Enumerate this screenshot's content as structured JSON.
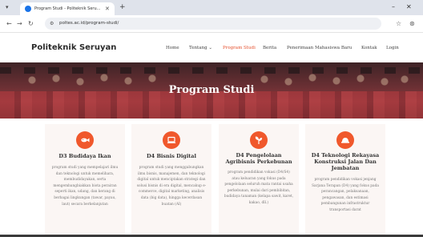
{
  "browser": {
    "tab_title": "Program Studi - Politeknik Seru...",
    "url": "poltes.ac.id/program-studi/",
    "tab_close_glyph": "✕",
    "new_tab_glyph": "+",
    "controls": {
      "minimize": "–",
      "maximize": "□",
      "close": "✕"
    },
    "icons": {
      "tab_list": "chevron-down-icon",
      "back": "arrow-left-icon",
      "forward": "arrow-right-icon",
      "reload": "reload-icon",
      "site_info": "tune-icon",
      "bookmark": "star-icon",
      "profile": "profile-icon"
    }
  },
  "site": {
    "brand": "Politeknik Seruyan",
    "nav": [
      {
        "label": "Home"
      },
      {
        "label": "Tentang ⌄"
      },
      {
        "label": "Program Studi"
      },
      {
        "label": "Berita"
      },
      {
        "label": "Penerimaan Mahasiswa Baru"
      },
      {
        "label": "Kontak"
      },
      {
        "label": "Login"
      }
    ],
    "active_nav": "Program Studi"
  },
  "hero": {
    "title": "Program Studi"
  },
  "programs": [
    {
      "icon": "fish-icon",
      "title": "D3 Budidaya Ikan",
      "description": "program studi yang mempelajari ilmu dan teknologi untuk memelihara, membudidayakan, serta mengembangbiakkan biota perairan seperti ikan, udang, dan kerang di berbagai lingkungan (tawar, payau, laut) secara berkelanjutan"
    },
    {
      "icon": "laptop-icon",
      "title": "D4 Bisnis Digital",
      "description": "program studi yang menggabungkan ilmu bisnis, manajemen, dan teknologi digital untuk menciptakan strategi dan solusi bisnis di era digital, mencakup e-commerce, digital marketing, analisis data (big data), hingga kecerdasan buatan (AI)"
    },
    {
      "icon": "plant-icon",
      "title": "D4 Pengelolaan Agribisnis Perkebunan",
      "description": "program pendidikan vokasi (D4/S4) atau keluaran yang fokus pada pengelolaan seluruh mata rantai usaha perkebunan, mulai dari pembibitan, budidaya tanaman (kelapa sawit, karet, kakao, dll.)"
    },
    {
      "icon": "construction-icon",
      "title": "D4 Teknologi Rekayasa Konstruksi Jalan Dan Jembatan",
      "description": "program pendidikan vokasi jenjang Sarjana Terapan (D4) yang fokus pada perancangan, pelaksanaan, pengawasan, dan estimasi pembangunan infrastruktur transportasi darat"
    }
  ],
  "colors": {
    "accent": "#f0582c",
    "active_nav": "#e5502d",
    "card_bg": "#fbf6f4",
    "hero_base": "#6c3034"
  }
}
